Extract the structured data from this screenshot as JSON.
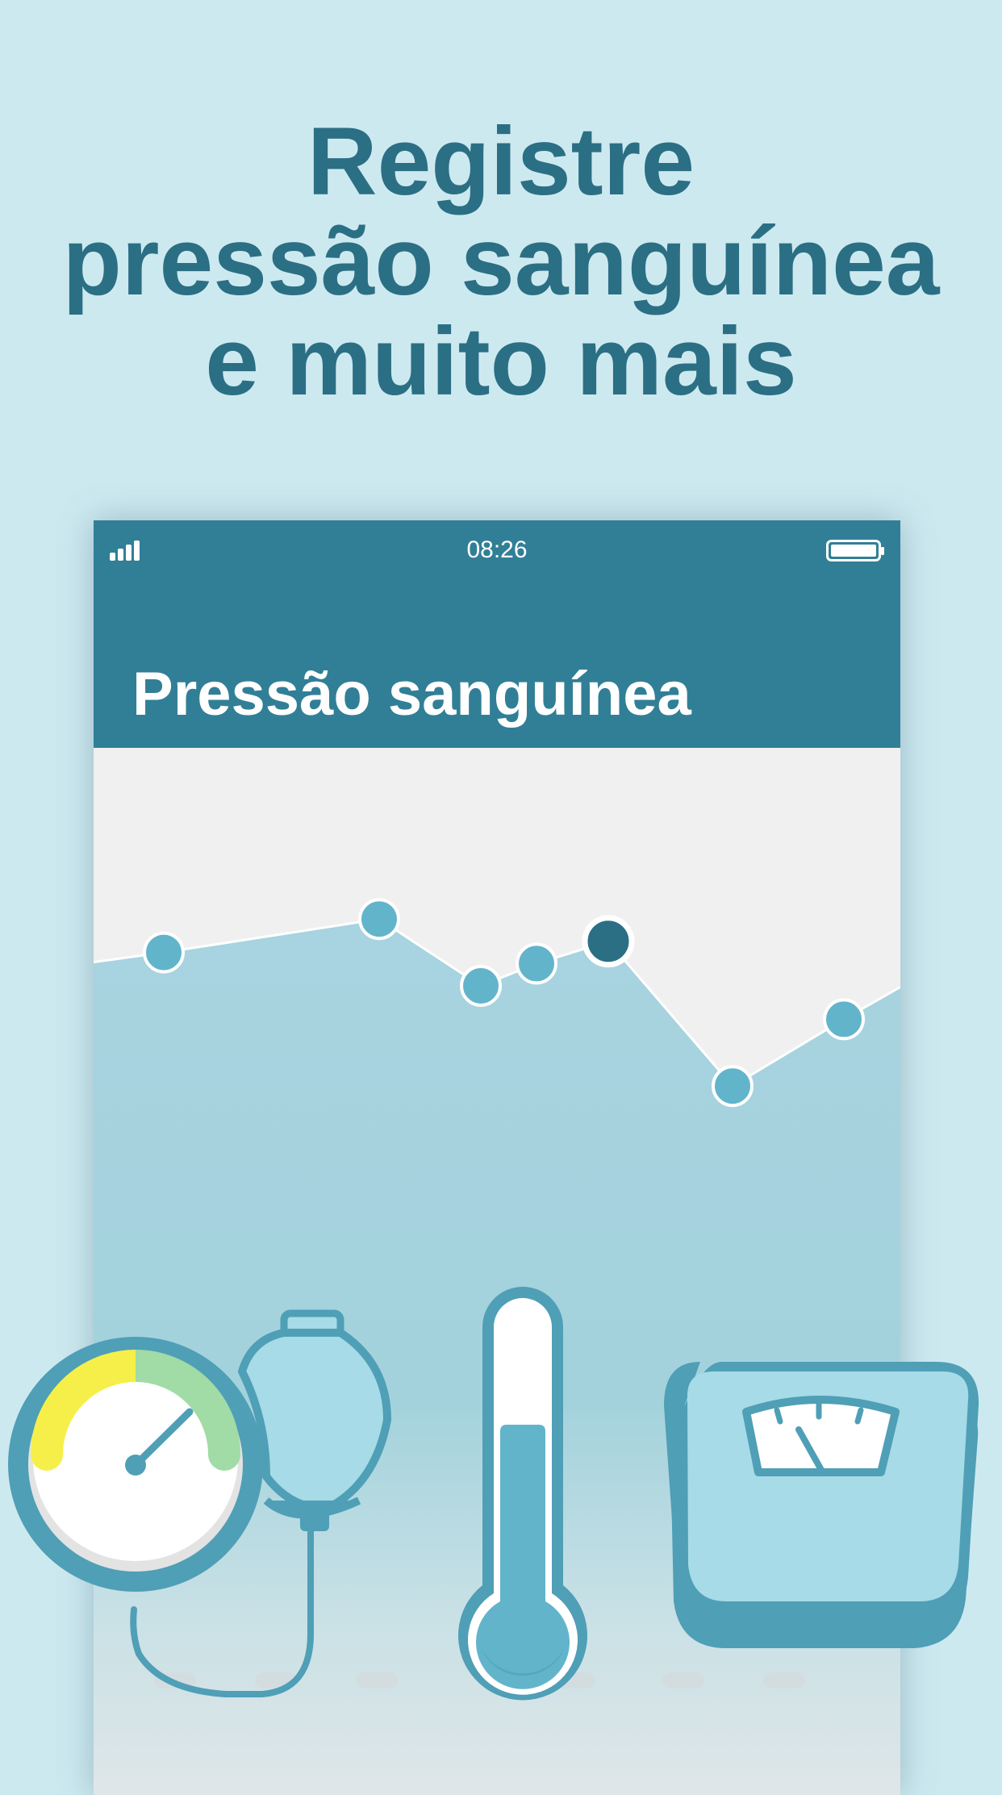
{
  "headline": {
    "line1": "Registre",
    "line2": "pressão sanguínea",
    "line3": "e muito mais"
  },
  "status_bar": {
    "time": "08:26",
    "signal_icon": "signal-bars-icon",
    "battery_icon": "battery-icon"
  },
  "screen": {
    "title": "Pressão sanguínea"
  },
  "colors": {
    "background": "#cde9f0",
    "accent": "#317f96",
    "headline": "#2b6f84",
    "point_fill": "#62b4cb",
    "point_selected": "#2b6f84"
  },
  "chart_data": {
    "type": "area",
    "x": [
      1,
      2,
      3,
      4,
      5,
      6,
      7
    ],
    "values": [
      68,
      71,
      65,
      67,
      69,
      56,
      62
    ],
    "selected_index": 4,
    "grid": false
  },
  "illustrations": [
    {
      "icon": "pressure-gauge-icon"
    },
    {
      "icon": "inflation-bulb-icon"
    },
    {
      "icon": "thermometer-icon"
    },
    {
      "icon": "weight-scale-icon"
    }
  ]
}
